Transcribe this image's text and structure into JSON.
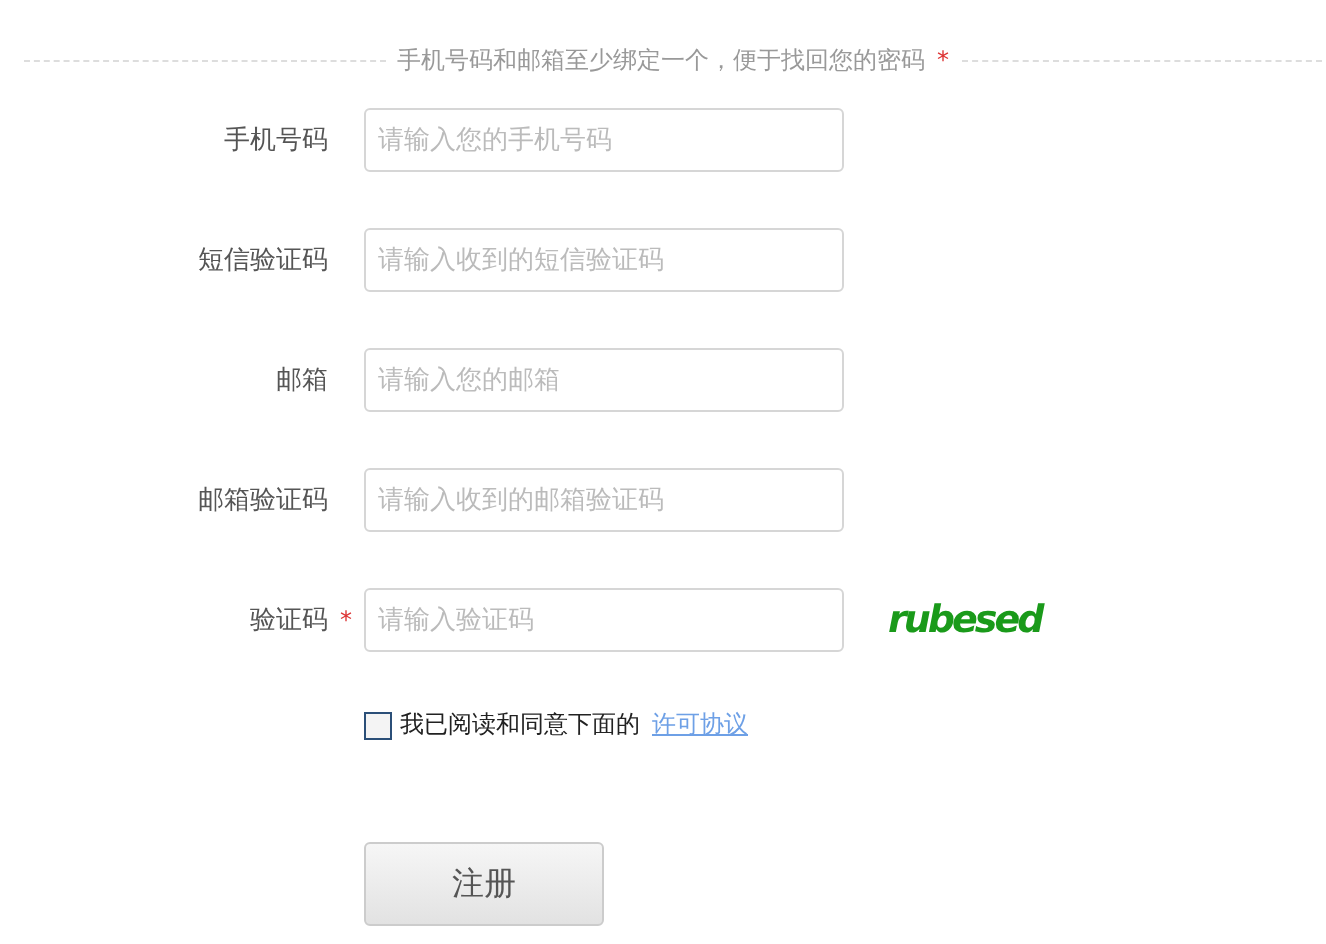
{
  "notice": {
    "text": "手机号码和邮箱至少绑定一个，便于找回您的密码",
    "mark": "*"
  },
  "fields": [
    {
      "label": "手机号码",
      "placeholder": "请输入您的手机号码",
      "required": false
    },
    {
      "label": "短信验证码",
      "placeholder": "请输入收到的短信验证码",
      "required": false
    },
    {
      "label": "邮箱",
      "placeholder": "请输入您的邮箱",
      "required": false
    },
    {
      "label": "邮箱验证码",
      "placeholder": "请输入收到的邮箱验证码",
      "required": false
    },
    {
      "label": "验证码",
      "placeholder": "请输入验证码",
      "required": true,
      "captcha": "rubesed"
    }
  ],
  "agreement": {
    "checked": false,
    "text": "我已阅读和同意下面的",
    "link": "许可协议"
  },
  "submit": "注册"
}
